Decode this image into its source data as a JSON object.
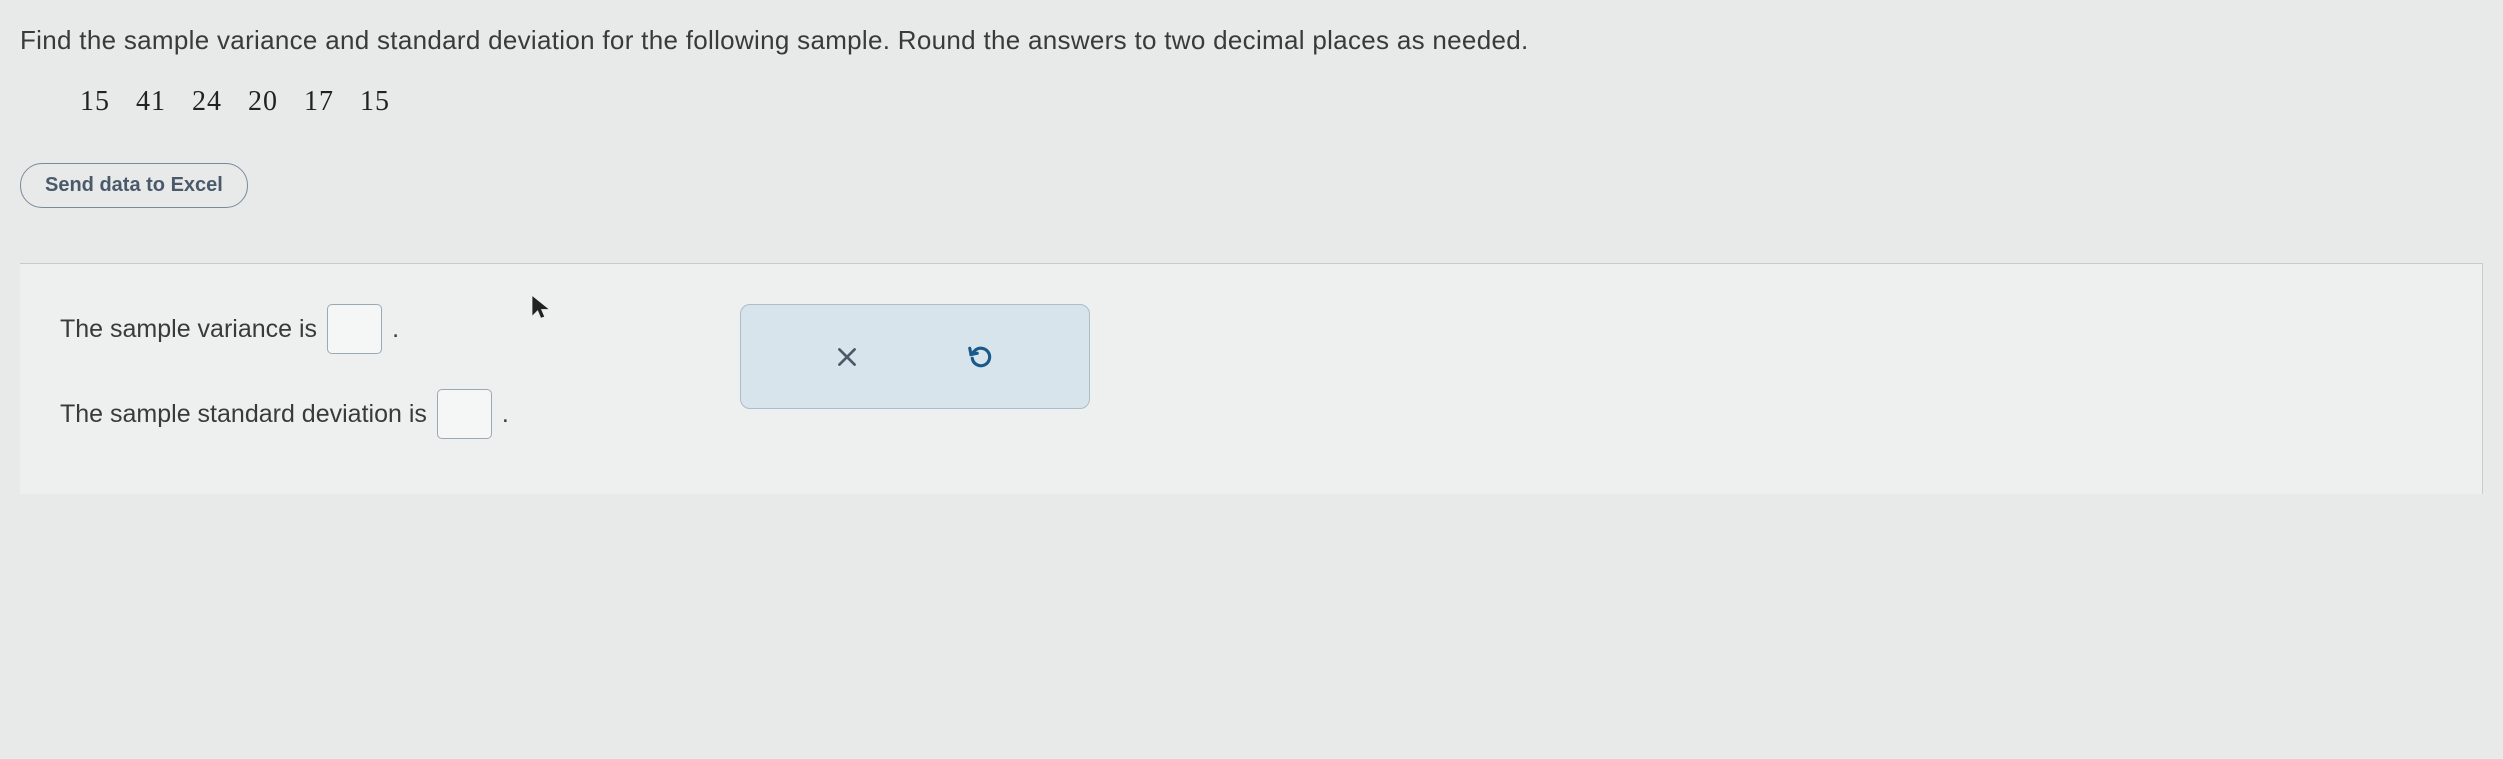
{
  "question": "Find the sample variance and standard deviation for the following sample. Round the answers to two decimal places as needed.",
  "data_values": "15  41  24  20  17  15",
  "excel_button_label": "Send data to Excel",
  "answer": {
    "variance_label_pre": "The sample variance is",
    "variance_value": "",
    "stddev_label_pre": "The sample standard deviation is",
    "stddev_value": ""
  },
  "icons": {
    "clear": "x-icon",
    "reset": "reset-icon",
    "cursor": "cursor-icon"
  }
}
